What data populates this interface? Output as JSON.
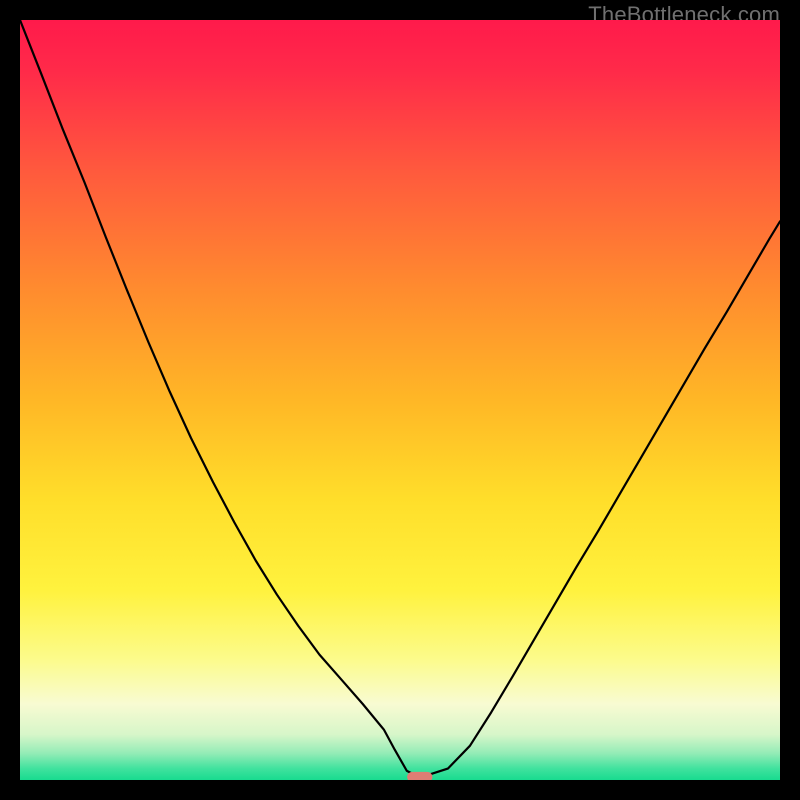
{
  "watermark": "TheBottleneck.com",
  "colors": {
    "gradient_stops": [
      {
        "offset": 0.0,
        "color": "#ff1a4b"
      },
      {
        "offset": 0.07,
        "color": "#ff2b49"
      },
      {
        "offset": 0.2,
        "color": "#ff5a3d"
      },
      {
        "offset": 0.35,
        "color": "#ff8a2f"
      },
      {
        "offset": 0.5,
        "color": "#ffb726"
      },
      {
        "offset": 0.63,
        "color": "#ffde2a"
      },
      {
        "offset": 0.75,
        "color": "#fff23e"
      },
      {
        "offset": 0.84,
        "color": "#fcfb8a"
      },
      {
        "offset": 0.9,
        "color": "#f8fbd2"
      },
      {
        "offset": 0.94,
        "color": "#d7f6c9"
      },
      {
        "offset": 0.965,
        "color": "#93ecb6"
      },
      {
        "offset": 0.985,
        "color": "#40e29e"
      },
      {
        "offset": 1.0,
        "color": "#18db8f"
      }
    ],
    "curve": "#000000",
    "marker_fill": "#de7d74",
    "marker_stroke": "#de7d74",
    "frame": "#000000"
  },
  "chart_data": {
    "type": "line",
    "title": "",
    "xlabel": "",
    "ylabel": "",
    "xlim": [
      0,
      100
    ],
    "ylim": [
      0,
      100
    ],
    "grid": false,
    "legend": false,
    "series": [
      {
        "name": "bottleneck-curve",
        "x": [
          0.0,
          2.8,
          5.6,
          8.5,
          11.3,
          14.1,
          16.9,
          19.7,
          22.5,
          25.4,
          28.2,
          31.0,
          33.8,
          36.6,
          39.4,
          42.3,
          45.1,
          47.9,
          49.3,
          50.9,
          52.1,
          53.5,
          56.3,
          59.2,
          62.0,
          64.8,
          67.6,
          70.4,
          73.2,
          76.1,
          78.9,
          81.7,
          84.5,
          87.3,
          90.1,
          93.0,
          95.8,
          98.6,
          100.0
        ],
        "y": [
          100.0,
          92.9,
          85.7,
          78.6,
          71.4,
          64.4,
          57.6,
          51.1,
          45.0,
          39.2,
          33.9,
          28.9,
          24.4,
          20.3,
          16.5,
          13.2,
          10.0,
          6.6,
          4.0,
          1.2,
          0.6,
          0.6,
          1.5,
          4.5,
          8.9,
          13.6,
          18.4,
          23.2,
          28.0,
          32.8,
          37.6,
          42.4,
          47.2,
          52.0,
          56.8,
          61.6,
          66.4,
          71.2,
          73.5
        ]
      }
    ],
    "annotations": [
      {
        "name": "optimal-marker",
        "shape": "rounded-pill",
        "x": 52.6,
        "y": 0.4,
        "width_units": 3.2,
        "height_units": 1.2
      }
    ]
  }
}
